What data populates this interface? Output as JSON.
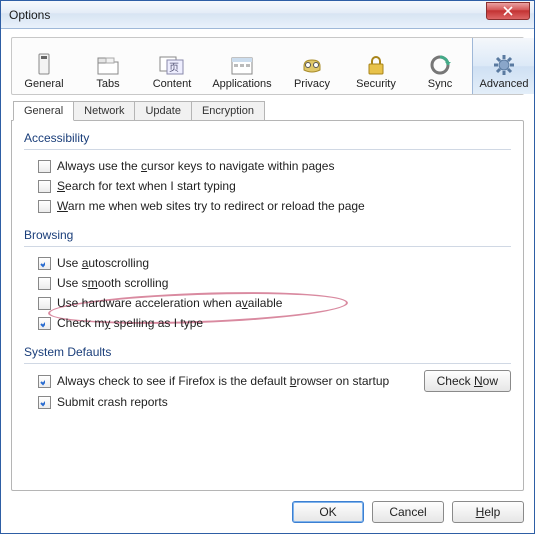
{
  "window": {
    "title": "Options"
  },
  "categories": [
    {
      "label": "General"
    },
    {
      "label": "Tabs"
    },
    {
      "label": "Content"
    },
    {
      "label": "Applications"
    },
    {
      "label": "Privacy"
    },
    {
      "label": "Security"
    },
    {
      "label": "Sync"
    },
    {
      "label": "Advanced"
    }
  ],
  "subtabs": [
    {
      "label": "General"
    },
    {
      "label": "Network"
    },
    {
      "label": "Update"
    },
    {
      "label": "Encryption"
    }
  ],
  "groups": {
    "accessibility": {
      "title": "Accessibility",
      "items": [
        {
          "checked": false,
          "pre": "Always use the ",
          "u": "c",
          "post": "ursor keys to navigate within pages"
        },
        {
          "checked": false,
          "pre": "",
          "u": "S",
          "post": "earch for text when I start typing"
        },
        {
          "checked": false,
          "pre": "",
          "u": "W",
          "post": "arn me when web sites try to redirect or reload the page"
        }
      ]
    },
    "browsing": {
      "title": "Browsing",
      "items": [
        {
          "checked": true,
          "pre": "Use ",
          "u": "a",
          "post": "utoscrolling"
        },
        {
          "checked": false,
          "pre": "Use s",
          "u": "m",
          "post": "ooth scrolling"
        },
        {
          "checked": false,
          "pre": "Use hardware acceleration when a",
          "u": "v",
          "post": "ailable"
        },
        {
          "checked": true,
          "pre": "Check m",
          "u": "y",
          "post": " spelling as I type"
        }
      ]
    },
    "system": {
      "title": "System Defaults",
      "items": [
        {
          "checked": true,
          "pre": "Always check to see if Firefox is the default ",
          "u": "b",
          "post": "rowser on startup"
        },
        {
          "checked": true,
          "pre": "Submit crash reports",
          "u": "",
          "post": ""
        }
      ],
      "button": {
        "pre": "Check ",
        "u": "N",
        "post": "ow"
      }
    }
  },
  "footer": {
    "ok": "OK",
    "cancel": "Cancel",
    "help_u": "H",
    "help_post": "elp"
  }
}
